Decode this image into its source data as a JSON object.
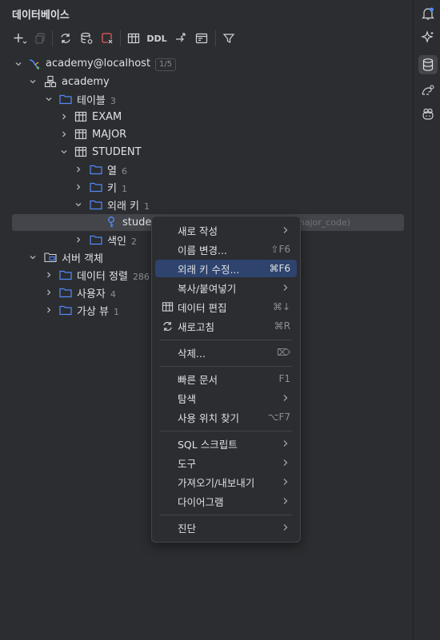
{
  "panel": {
    "title": "데이터베이스"
  },
  "toolbar": {
    "ddl_label": "DDL"
  },
  "tree": {
    "connection": {
      "label": "academy@localhost",
      "badge": "1/5"
    },
    "schema": {
      "label": "academy"
    },
    "tables_folder": {
      "label": "테이블",
      "count": "3"
    },
    "tables": [
      "EXAM",
      "MAJOR",
      "STUDENT"
    ],
    "columns_folder": {
      "label": "열",
      "count": "6"
    },
    "keys_folder": {
      "label": "키",
      "count": "1"
    },
    "fk_folder": {
      "label": "외래 키",
      "count": "1"
    },
    "fk_item": {
      "label": "stude",
      "ghost": "major_code)"
    },
    "indexes_folder": {
      "label": "색인",
      "count": "2"
    },
    "server_objects": {
      "label": "서버 객체"
    },
    "data_sorting": {
      "label": "데이터 정렬",
      "count": "286"
    },
    "users": {
      "label": "사용자",
      "count": "4"
    },
    "virtual_views": {
      "label": "가상 뷰",
      "count": "1"
    }
  },
  "context_menu": {
    "new": "새로 작성",
    "rename": {
      "label": "이름 변경...",
      "shortcut": "⇧F6"
    },
    "edit_fk": {
      "label": "외래 키 수정...",
      "shortcut": "⌘F6"
    },
    "copy_paste": "복사/붙여넣기",
    "edit_data": {
      "label": "데이터 편집",
      "shortcut": "⌘↓"
    },
    "refresh": {
      "label": "새로고침",
      "shortcut": "⌘R"
    },
    "delete": {
      "label": "삭제...",
      "shortcut": "⌦"
    },
    "quick_doc": {
      "label": "빠른 문서",
      "shortcut": "F1"
    },
    "navigate": "탐색",
    "find_usages": {
      "label": "사용 위치 찾기",
      "shortcut": "⌥F7"
    },
    "sql_scripts": "SQL 스크립트",
    "tools": "도구",
    "import_export": "가져오기/내보내기",
    "diagrams": "다이어그램",
    "diagnostics": "진단"
  },
  "colors": {
    "accent": "#548af7",
    "highlight": "#2e436e",
    "folder": "#548af7"
  }
}
